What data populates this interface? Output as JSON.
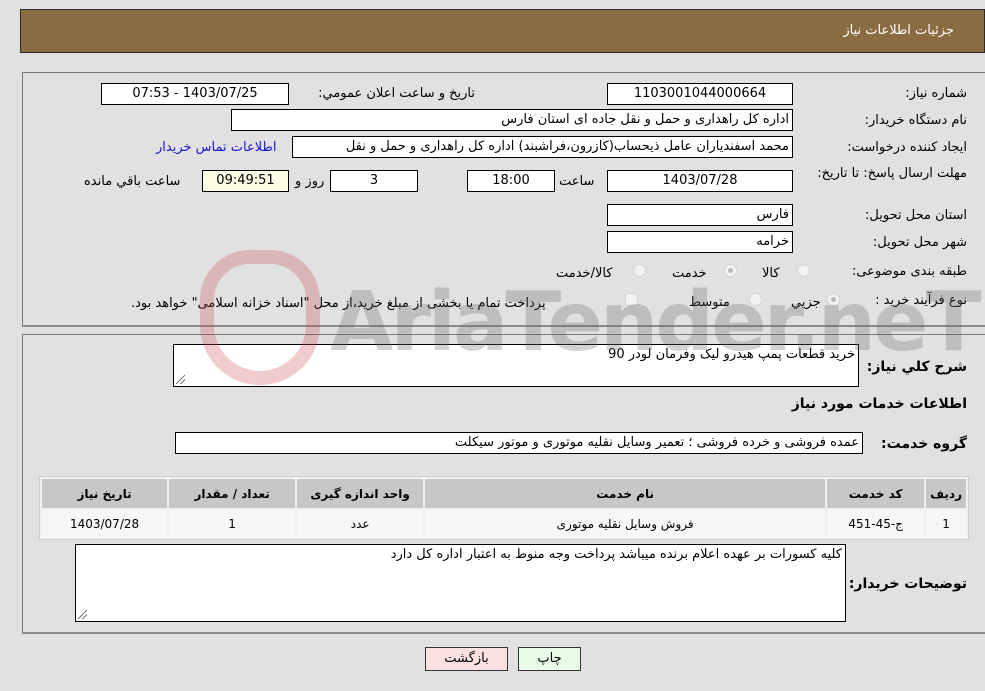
{
  "header": {
    "title": "جزئيات اطلاعات نياز"
  },
  "details": {
    "need_number_label": "شماره نیاز:",
    "need_number": "1103001044000664",
    "announce_label": "تاريخ و ساعت اعلان عمومي:",
    "announce_value": "1403/07/25 - 07:53",
    "buyer_org_label": "نام دستگاه خريدار:",
    "buyer_org": "اداره کل راهداری و حمل و نقل جاده ای استان فارس",
    "creator_label": "ايجاد کننده درخواست:",
    "creator": "محمد اسفندياران عامل ذيحساب(کازرون،فراشبند) اداره کل راهداری و حمل و نقل",
    "contact_link": "اطلاعات تماس خريدار",
    "deadline_label": "مهلت ارسال پاسخ: تا تاريخ:",
    "deadline_date": "1403/07/28",
    "time_label": "ساعت",
    "deadline_time": "18:00",
    "days_value": "3",
    "days_label": "روز و",
    "remaining_time": "09:49:51",
    "remaining_label": "ساعت باقي مانده",
    "province_label": "استان محل تحويل:",
    "province": "فارس",
    "city_label": "شهر محل تحويل:",
    "city": "خرامه",
    "category_label": "طبقه بندی موضوعی:",
    "category_options": [
      "کالا",
      "خدمت",
      "کالا/خدمت"
    ],
    "category_selected": "خدمت",
    "process_label": "نوع فرآيند خريد :",
    "process_options": [
      "جزيي",
      "متوسط"
    ],
    "process_selected": "جزيي",
    "treasury_note": "پرداخت تمام يا بخشی از مبلغ خريد،از محل \"اسناد خزانه اسلامی\" خواهد بود."
  },
  "summary": {
    "description_label": "شرح کلي نياز:",
    "description": "خريد قطعات پمپ هيدرو ليک وفرمان لودر 90",
    "services_title": "اطلاعات خدمات مورد نياز",
    "group_label": "گروه خدمت:",
    "group_value": "عمده فروشی و خرده فروشی ؛ تعمير وسايل نقليه موتوری و موتور سيکلت"
  },
  "table": {
    "headers": [
      "رديف",
      "کد خدمت",
      "نام خدمت",
      "واحد اندازه گيری",
      "تعداد / مقدار",
      "تاريخ نياز"
    ],
    "rows": [
      [
        "1",
        "ج-45-451",
        "فروش وسايل نقليه موتوری",
        "عدد",
        "1",
        "1403/07/28"
      ]
    ]
  },
  "buyer_notes": {
    "label": "توضيحات خريدار:",
    "text": "کليه کسورات بر عهده اعلام برنده ميباشد پرداخت وجه منوط به اعتبار اداره کل دارد"
  },
  "buttons": {
    "print": "چاپ",
    "back": "بازگشت"
  },
  "watermark": {
    "text": "AriaTender.neT"
  }
}
